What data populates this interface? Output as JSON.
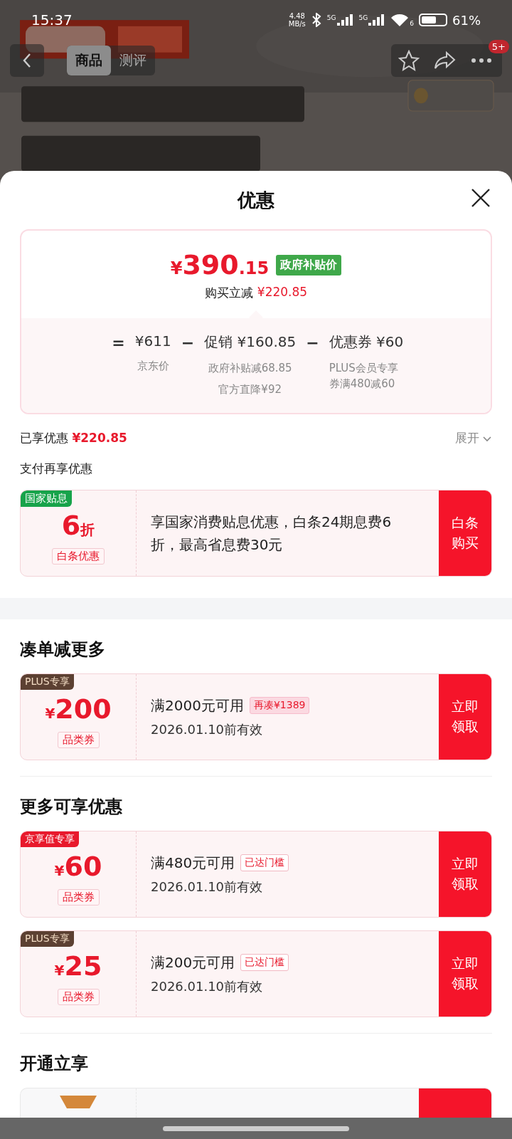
{
  "status_bar": {
    "time": "15:37",
    "speed_value": "4.48",
    "speed_unit": "MB/s",
    "signals": [
      {
        "label": "5G"
      },
      {
        "label": "5G"
      }
    ],
    "wifi_label": "6",
    "battery_text": "61%"
  },
  "nav": {
    "tabs": [
      {
        "label": "商品",
        "selected": true
      },
      {
        "label": "测评",
        "selected": false
      }
    ],
    "badge": "5+"
  },
  "sheet": {
    "title": "优惠",
    "price_card": {
      "currency": "¥",
      "integer": "390",
      "decimal": ".15",
      "tag": "政府补贴价",
      "subtitle": "购买立减",
      "subtitle_amount": "¥220.85",
      "breakdown": [
        {
          "operator": "=",
          "amount": "¥611",
          "notes": [
            "京东价"
          ]
        },
        {
          "operator": "−",
          "label": "促销",
          "amount": "¥160.85",
          "notes": [
            "政府补贴减68.85",
            "官方直降¥92"
          ]
        },
        {
          "operator": "−",
          "label": "优惠券",
          "amount": "¥60",
          "notes": [
            "PLUS会员专享券满480减60"
          ]
        }
      ]
    },
    "enjoyed": {
      "label": "已享优惠",
      "amount": "¥220.85",
      "expand": "展开"
    },
    "pay_title": "支付再享优惠",
    "pay_offer": {
      "tag": "国家贴息",
      "amount": "6",
      "unit": "折",
      "type": "白条优惠",
      "description": "享国家消费贴息优惠，白条24期息费6折，最高省息费30元",
      "button": "白条购买"
    },
    "sections": [
      {
        "title": "凑单减更多",
        "coupons": [
          {
            "badge": {
              "text": "PLUS专享",
              "color": "#5c4032"
            },
            "currency": "¥",
            "amount": "200",
            "type": "品类券",
            "condition": "满2000元可用",
            "chip": {
              "text": "再凑¥1389",
              "kind": "shortfall"
            },
            "validity": "2026.01.10前有效",
            "button": "立即领取"
          }
        ]
      },
      {
        "title": "更多可享优惠",
        "coupons": [
          {
            "badge": {
              "text": "京享值专享",
              "color": "#e8192c"
            },
            "currency": "¥",
            "amount": "60",
            "type": "品类券",
            "condition": "满480元可用",
            "chip": {
              "text": "已达门槛",
              "kind": "reached"
            },
            "validity": "2026.01.10前有效",
            "button": "立即领取"
          },
          {
            "badge": {
              "text": "PLUS专享",
              "color": "#5c4032"
            },
            "currency": "¥",
            "amount": "25",
            "type": "品类券",
            "condition": "满200元可用",
            "chip": {
              "text": "已达门槛",
              "kind": "reached"
            },
            "validity": "2026.01.10前有效",
            "button": "立即领取"
          }
        ]
      },
      {
        "title": "开通立享",
        "coupons": [
          {
            "kind": "partial"
          }
        ]
      }
    ]
  }
}
